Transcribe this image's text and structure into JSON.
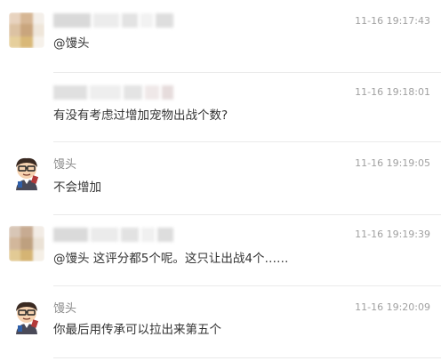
{
  "comments": [
    {
      "author": "",
      "time": "11-16 19:17:43",
      "text": "@馒头"
    },
    {
      "author": "",
      "time": "11-16 19:18:01",
      "text": "有没有考虑过增加宠物出战个数?"
    },
    {
      "author": "馒头",
      "time": "11-16 19:19:05",
      "text": "不会增加"
    },
    {
      "author": "",
      "time": "11-16 19:19:39",
      "text": "@馒头 这评分都5个呢。这只让出战4个……"
    },
    {
      "author": "馒头",
      "time": "11-16 19:20:09",
      "text": "你最后用传承可以拉出来第五个"
    }
  ],
  "icons": {
    "blurred_avatar": "blurred-avatar",
    "cartoon_avatar": "cartoon-avatar-icon"
  },
  "colors": {
    "timestamp": "#a0a0a0",
    "author": "#8a8a8a",
    "text": "#333333",
    "divider": "#eaeaea"
  }
}
